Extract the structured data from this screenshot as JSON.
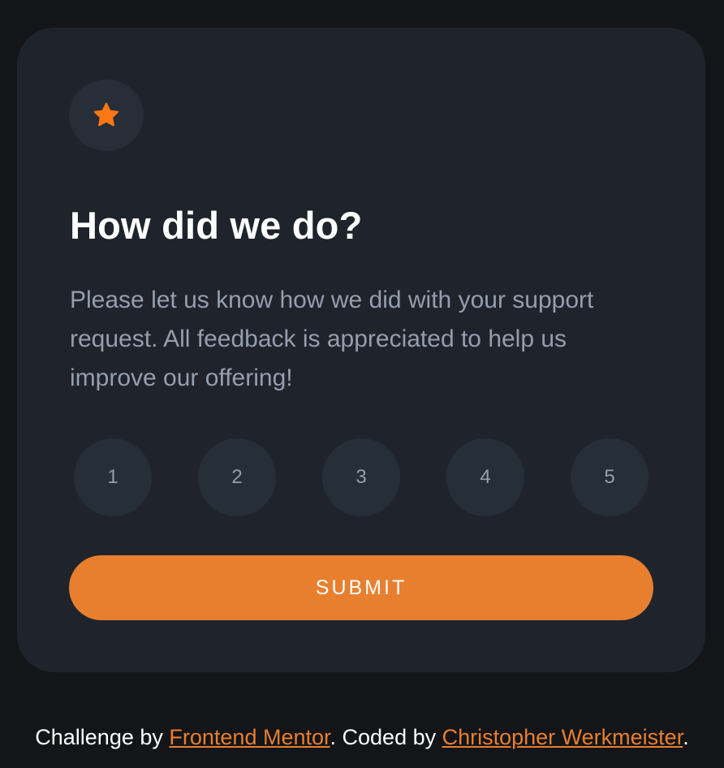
{
  "card": {
    "icon": "star-icon",
    "title": "How did we do?",
    "description": "Please let us know how we did with your support request. All feedback is appreciated to help us improve our offering!",
    "ratings": [
      "1",
      "2",
      "3",
      "4",
      "5"
    ],
    "submit_label": "SUBMIT"
  },
  "attribution": {
    "prefix": "Challenge by ",
    "link1": "Frontend Mentor",
    "middle": ". Coded by ",
    "link2": "Christopher Werkmeister",
    "suffix": "."
  },
  "colors": {
    "page_background": "#131518",
    "card_background": "#1f242c",
    "accent": "#e87f2f",
    "muted_text": "#959eac",
    "rating_background": "#262e38"
  }
}
